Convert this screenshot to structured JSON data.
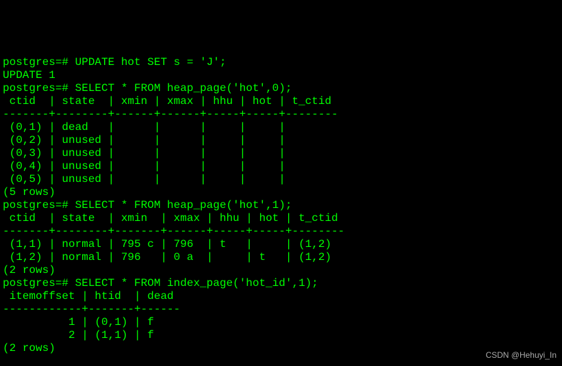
{
  "prompt": "postgres=#",
  "cmd1": "UPDATE hot SET s = 'J';",
  "out1": "UPDATE 1",
  "cmd2": "SELECT * FROM heap_page('hot',0);",
  "table1": {
    "header": " ctid  | state  | xmin | xmax | hhu | hot | t_ctid",
    "sep": "-------+--------+------+------+-----+-----+--------",
    "rows": [
      " (0,1) | dead   |      |      |     |     |",
      " (0,2) | unused |      |      |     |     |",
      " (0,3) | unused |      |      |     |     |",
      " (0,4) | unused |      |      |     |     |",
      " (0,5) | unused |      |      |     |     |"
    ],
    "footer": "(5 rows)"
  },
  "cmd3": "SELECT * FROM heap_page('hot',1);",
  "table2": {
    "header": " ctid  | state  | xmin  | xmax | hhu | hot | t_ctid",
    "sep": "-------+--------+-------+------+-----+-----+--------",
    "rows": [
      " (1,1) | normal | 795 c | 796  | t   |     | (1,2)",
      " (1,2) | normal | 796   | 0 a  |     | t   | (1,2)"
    ],
    "footer": "(2 rows)"
  },
  "cmd4": "SELECT * FROM index_page('hot_id',1);",
  "table3": {
    "header": " itemoffset | htid  | dead",
    "sep": "------------+-------+------",
    "rows": [
      "          1 | (0,1) | f",
      "          2 | (1,1) | f"
    ],
    "footer": "(2 rows)"
  },
  "watermark": "CSDN @Hehuyi_In"
}
